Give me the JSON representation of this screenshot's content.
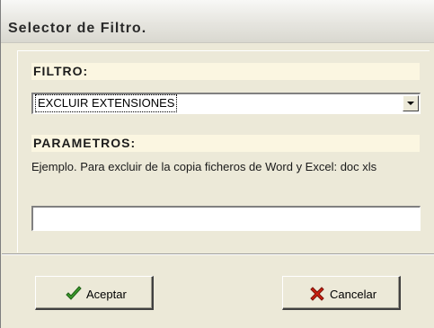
{
  "window": {
    "title": "Selector de Filtro."
  },
  "filter": {
    "label": "FILTRO:",
    "selected": "EXCLUIR EXTENSIONES"
  },
  "parameters": {
    "label": "PARAMETROS:",
    "example": "Ejemplo. Para excluir de la copia ficheros de Word y Excel: doc xls",
    "value": ""
  },
  "buttons": {
    "accept": {
      "label": "Aceptar",
      "icon": "checkmark-icon",
      "icon_color": "#3a9a2a"
    },
    "cancel": {
      "label": "Cancelar",
      "icon": "red-x-icon",
      "icon_color": "#cc1f10"
    }
  }
}
